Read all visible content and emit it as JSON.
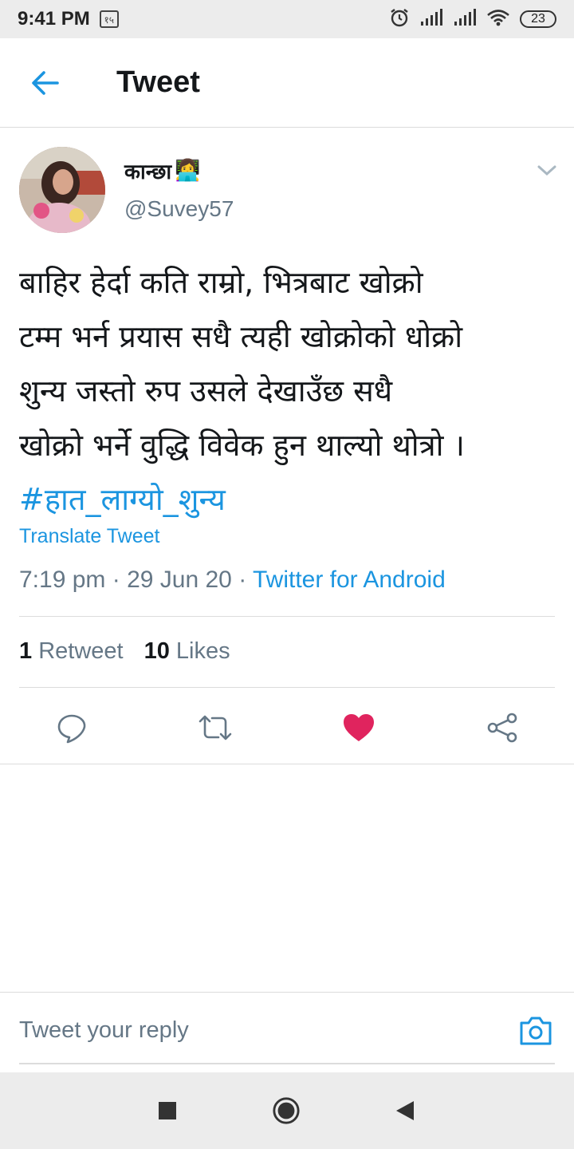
{
  "status_bar": {
    "time": "9:41 PM",
    "notification_badge": "१५",
    "battery": "23",
    "icons": [
      "alarm-icon",
      "signal-icon",
      "signal-icon",
      "wifi-icon",
      "battery-icon"
    ]
  },
  "header": {
    "title": "Tweet",
    "back_icon": "back-arrow-icon"
  },
  "tweet": {
    "author_name": "कान्छा",
    "author_emoji": "👩‍💻",
    "author_handle": "@Suvey57",
    "text_lines": [
      "बाहिर हेर्दा कति राम्रो, भित्रबाट खोक्रो",
      "टम्म भर्न प्रयास सधै त्यही खोक्रोको धोक्रो",
      "शुन्य जस्तो रुप उसले देखाउँछ सधै",
      "खोक्रो भर्ने वुद्धि विवेक हुन थाल्यो थोत्रो ।"
    ],
    "hashtag": "#हात_लाग्यो_शुन्य",
    "translate_label": "Translate Tweet",
    "time": "7:19 pm",
    "date": "29 Jun 20",
    "separator": " · ",
    "source": "Twitter for Android",
    "retweet_count": "1",
    "retweet_label": "Retweet",
    "like_count": "10",
    "like_label": "Likes"
  },
  "actions": {
    "icons": [
      "reply-icon",
      "retweet-icon",
      "like-icon",
      "share-icon"
    ],
    "like_color": "#e0245e",
    "icon_color": "#657786"
  },
  "reply": {
    "placeholder": "Tweet your reply"
  },
  "colors": {
    "accent": "#1b95e0",
    "secondary_text": "#657786"
  }
}
